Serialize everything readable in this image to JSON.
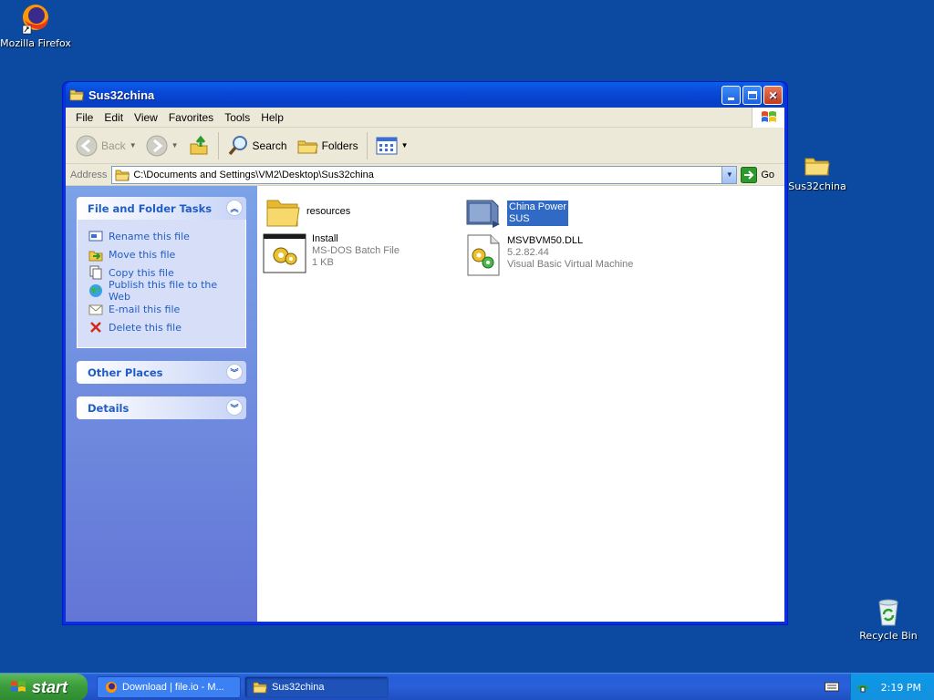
{
  "desktop": {
    "icons": [
      {
        "label": "Mozilla Firefox",
        "icon": "firefox-icon"
      },
      {
        "label": "Sus32china",
        "icon": "folder-icon"
      },
      {
        "label": "Recycle Bin",
        "icon": "recycle-bin-icon"
      }
    ]
  },
  "window": {
    "title": "Sus32china",
    "menu": [
      "File",
      "Edit",
      "View",
      "Favorites",
      "Tools",
      "Help"
    ],
    "toolbar": {
      "back": "Back",
      "search": "Search",
      "folders": "Folders"
    },
    "address": {
      "label": "Address",
      "path": "C:\\Documents and Settings\\VM2\\Desktop\\Sus32china",
      "go": "Go"
    },
    "tasks_panel": {
      "title": "File and Folder Tasks",
      "items": [
        "Rename this file",
        "Move this file",
        "Copy this file",
        "Publish this file to the Web",
        "E-mail this file",
        "Delete this file"
      ]
    },
    "other_places": {
      "title": "Other Places"
    },
    "details": {
      "title": "Details"
    },
    "files": [
      {
        "name": "resources",
        "line2": "",
        "line3": "",
        "icon": "folder-icon"
      },
      {
        "name": "China Power",
        "line2": "SUS",
        "line3": "",
        "icon": "shortcut-icon",
        "selected": true
      },
      {
        "name": "Install",
        "line2": "MS-DOS Batch File",
        "line3": "1 KB",
        "icon": "batch-file-icon"
      },
      {
        "name": "MSVBVM50.DLL",
        "line2": "5.2.82.44",
        "line3": "Visual Basic Virtual Machine",
        "icon": "dll-icon"
      }
    ]
  },
  "taskbar": {
    "start": "start",
    "tasks": [
      {
        "label": "Download | file.io - M...",
        "icon": "firefox-icon"
      },
      {
        "label": "Sus32china",
        "icon": "folder-icon",
        "active": true
      }
    ],
    "clock": "2:19 PM"
  },
  "colors": {
    "desktop": "#0b4aa0",
    "titlebar": "#0a48d8",
    "task_pane": "#7ba2e7",
    "selection": "#316ac5",
    "start": "#3b9b3b"
  }
}
